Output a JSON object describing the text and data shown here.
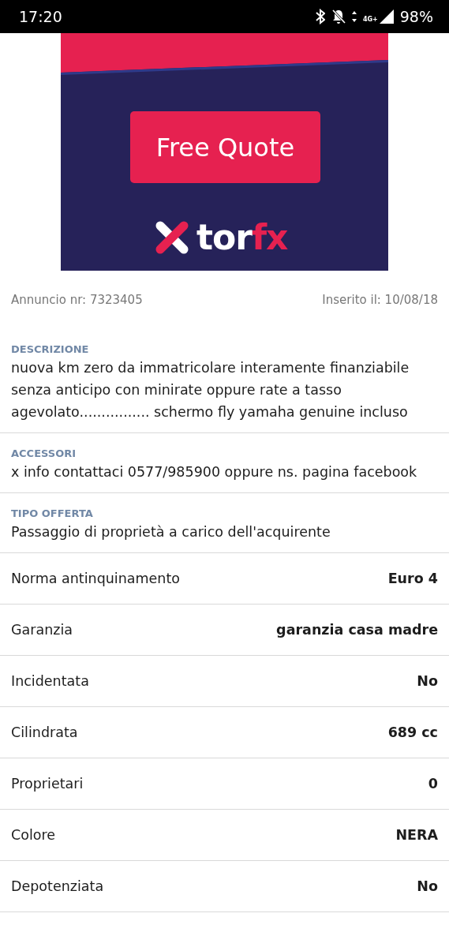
{
  "status_bar": {
    "time": "17:20",
    "battery": "98%",
    "network": "4G+"
  },
  "ad": {
    "button": "Free Quote",
    "logo_parts": [
      "tor",
      "fx"
    ]
  },
  "meta": {
    "listing_number": "Annuncio nr: 7323405",
    "posted": "Inserito il: 10/08/18"
  },
  "sections": [
    {
      "heading": "DESCRIZIONE",
      "text": "nuova km zero da immatricolare interamente finanziabile senza anticipo con minirate oppure rate a tasso agevolato................ schermo fly yamaha genuine incluso"
    },
    {
      "heading": "ACCESSORI",
      "text": "x info contattaci 0577/985900 oppure ns. pagina facebook"
    },
    {
      "heading": "TIPO OFFERTA",
      "text": "Passaggio di proprietà a carico dell'acquirente"
    }
  ],
  "specs": [
    {
      "label": "Norma antinquinamento",
      "value": "Euro 4"
    },
    {
      "label": "Garanzia",
      "value": "garanzia casa madre"
    },
    {
      "label": "Incidentata",
      "value": "No"
    },
    {
      "label": "Cilindrata",
      "value": "689 cc"
    },
    {
      "label": "Proprietari",
      "value": "0"
    },
    {
      "label": "Colore",
      "value": "NERA"
    },
    {
      "label": "Depotenziata",
      "value": "No"
    }
  ]
}
